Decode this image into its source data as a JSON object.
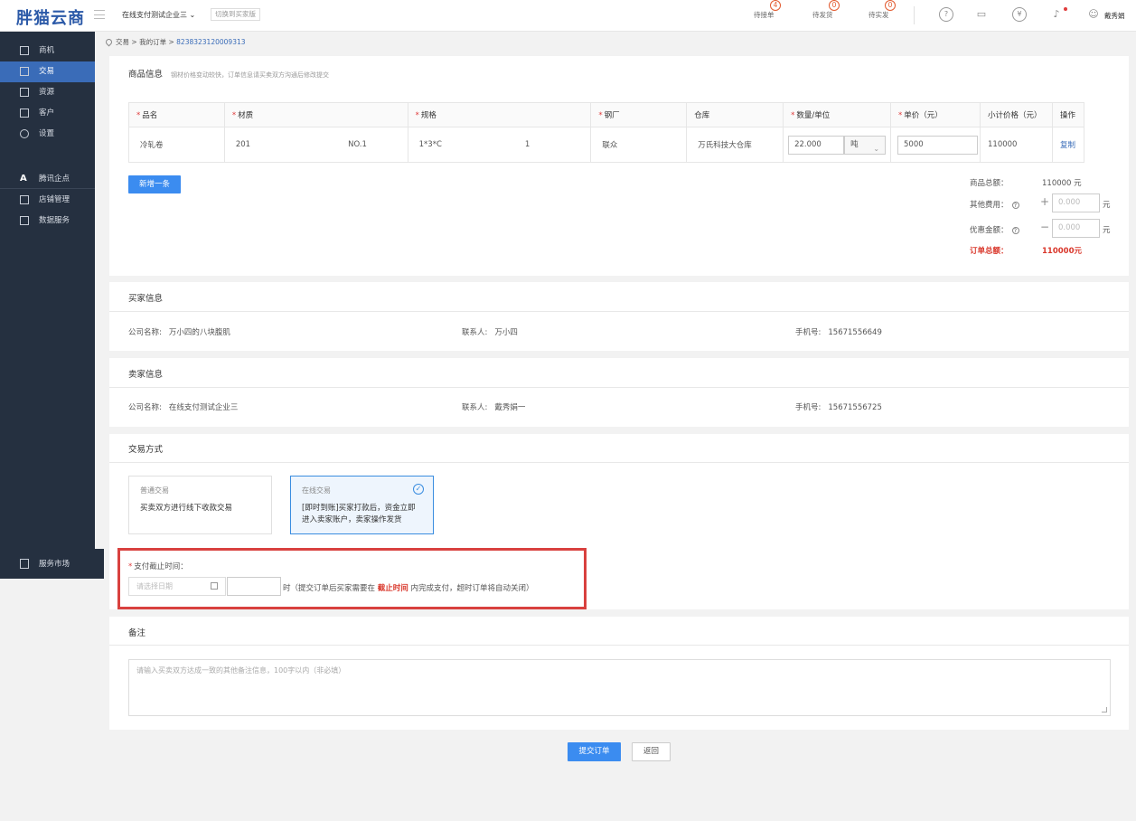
{
  "header": {
    "logo": "胖猫云商",
    "company": "在线支付测试企业三",
    "company_chevron": "⌄",
    "switch_buyer": "切换到买家版",
    "stats": [
      {
        "label": "待接单",
        "count": "4"
      },
      {
        "label": "待发货",
        "count": "0"
      },
      {
        "label": "待实发",
        "count": "0"
      }
    ],
    "user": "戴秀娟"
  },
  "sidebar": {
    "items": [
      {
        "label": "商机",
        "icon": "document-icon"
      },
      {
        "label": "交易",
        "icon": "book-icon"
      },
      {
        "label": "资源",
        "icon": "grid-icon"
      },
      {
        "label": "客户",
        "icon": "contact-icon"
      },
      {
        "label": "设置",
        "icon": "gear-icon"
      }
    ],
    "extra_items": [
      {
        "label": "腾讯企点",
        "icon": "a-letter-icon"
      },
      {
        "label": "店铺管理",
        "icon": "store-icon"
      },
      {
        "label": "数据服务",
        "icon": "data-icon"
      }
    ],
    "service_market": "服务市场",
    "active": "交易"
  },
  "breadcrumb": {
    "items": [
      "交易",
      "我的订单"
    ],
    "separator": ">",
    "order_no": "8238323120009313"
  },
  "goods": {
    "title": "商品信息",
    "subtitle": "钢材价格变动较快，订单信息请买卖双方沟通后修改提交",
    "columns": [
      {
        "label": "品名",
        "required": true
      },
      {
        "label": "材质",
        "required": true
      },
      {
        "label": "规格",
        "required": true
      },
      {
        "label": "钢厂",
        "required": true
      },
      {
        "label": "仓库",
        "required": false
      },
      {
        "label": "数量/单位",
        "required": true
      },
      {
        "label": "单价（元）",
        "required": true
      },
      {
        "label": "小计价格（元）",
        "required": false
      },
      {
        "label": "操作",
        "required": false
      }
    ],
    "rows": [
      {
        "name": "冷轧卷",
        "material": "201",
        "material_grade": "NO.1",
        "spec": "1*3*C",
        "spec_count": "1",
        "mill": "联众",
        "warehouse": "万氏科技大仓库",
        "quantity": "22.000",
        "unit": "吨",
        "price": "5000",
        "subtotal": "110000",
        "action": "复制"
      }
    ],
    "add_button": "新增一条",
    "summary": {
      "goods_total_label": "商品总额：",
      "goods_total_value": "110000 元",
      "other_fee_label": "其他费用：",
      "other_fee_placeholder": "0.000",
      "discount_label": "优惠金额：",
      "discount_placeholder": "0.000",
      "unit": "元",
      "help_glyph": "?",
      "plus": "+",
      "minus": "−",
      "order_total_label": "订单总额：",
      "order_total_value": "110000元"
    }
  },
  "buyer": {
    "title": "买家信息",
    "company_label": "公司名称:",
    "company": "万小四的八块腹肌",
    "contact_label": "联系人:",
    "contact": "万小四",
    "phone_label": "手机号:",
    "phone": "15671556649"
  },
  "seller": {
    "title": "卖家信息",
    "company_label": "公司名称:",
    "company": "在线支付测试企业三",
    "contact_label": "联系人:",
    "contact": "戴秀娟一",
    "phone_label": "手机号:",
    "phone": "15671556725"
  },
  "trade": {
    "title": "交易方式",
    "modes": [
      {
        "title": "普通交易",
        "desc": "买卖双方进行线下收款交易",
        "selected": false
      },
      {
        "title": "在线交易",
        "desc": "[即时到账]买家打款后，资金立即进入卖家账户，卖家操作发货",
        "selected": true
      }
    ],
    "check_glyph": "✓"
  },
  "deadline": {
    "label": "支付截止时间：",
    "date_placeholder": "请选择日期",
    "hint_prefix": "时（提交订单后买家需要在",
    "hint_em": "截止时间",
    "hint_suffix": "内完成支付，超时订单将自动关闭）"
  },
  "notes": {
    "title": "备注",
    "placeholder": "请输入买卖双方达成一致的其他备注信息，100字以内（非必填）"
  },
  "actions": {
    "submit": "提交订单",
    "back": "返回"
  },
  "colors": {
    "primary": "#3b8cf0",
    "sidebar_bg": "#253040",
    "highlight_border": "#d9413f",
    "total_red": "#d9372b"
  }
}
